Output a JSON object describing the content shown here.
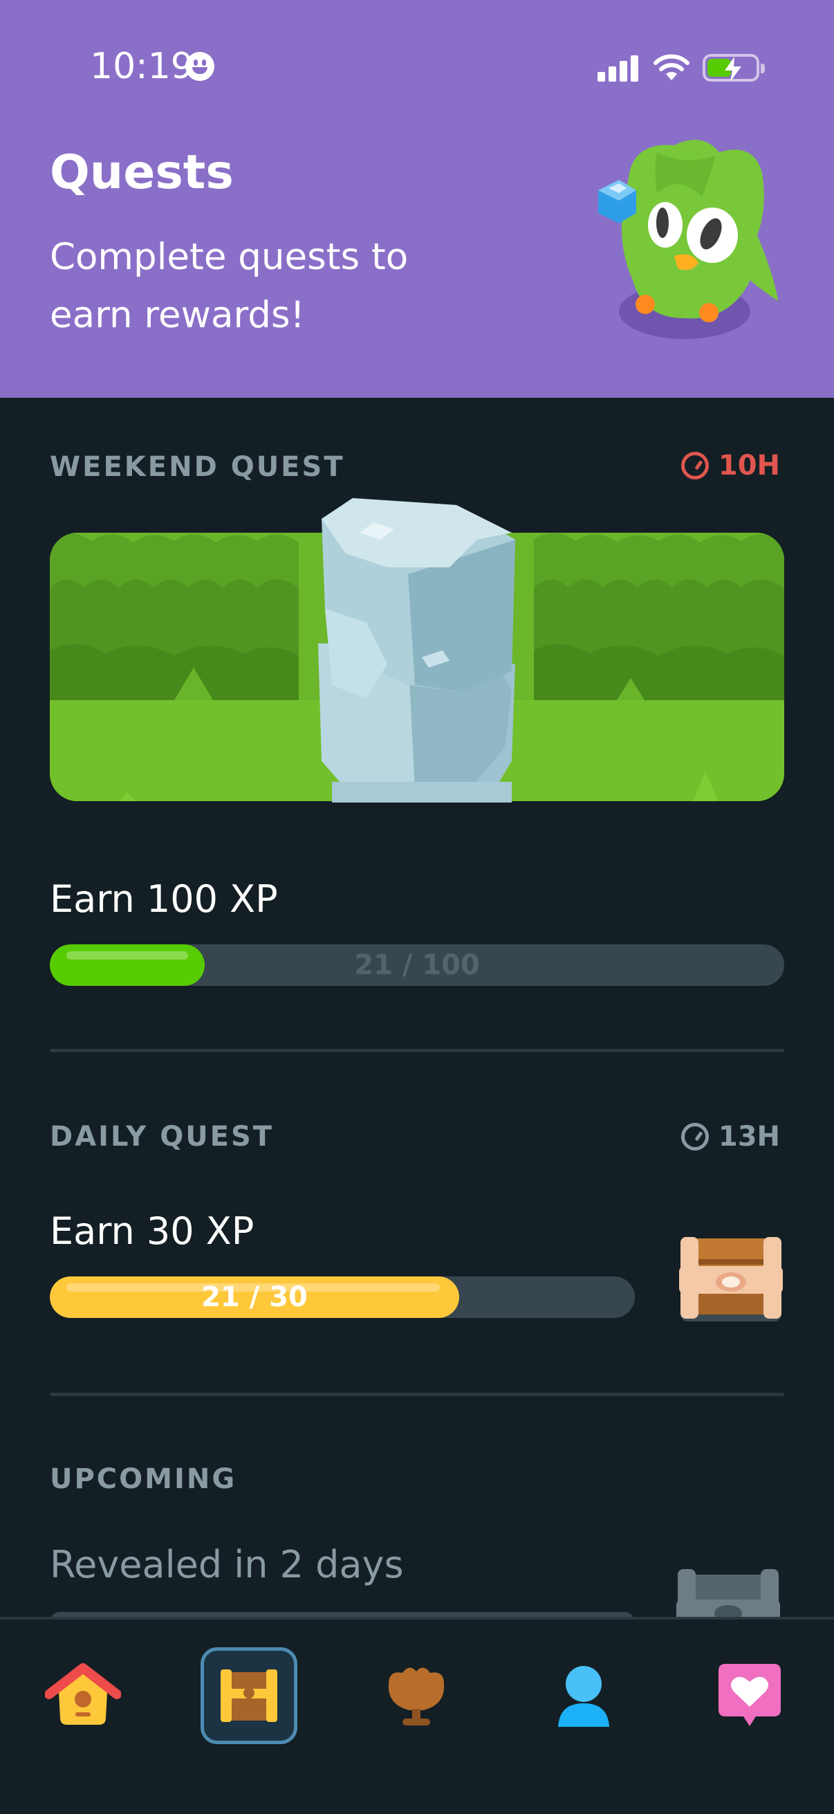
{
  "status_bar": {
    "time": "10:19"
  },
  "header": {
    "title": "Quests",
    "subtitle": "Complete quests to earn rewards!"
  },
  "weekend_quest": {
    "section_label": "WEEKEND QUEST",
    "timer": "10H",
    "timer_color": "#e0564e",
    "quest": {
      "name": "Earn 100 XP",
      "progress_text": "21 / 100",
      "progress_fraction": 0.21
    }
  },
  "daily_quest": {
    "section_label": "DAILY QUEST",
    "timer": "13H",
    "quest": {
      "name": "Earn 30 XP",
      "progress_text": "21 / 30",
      "progress_fraction": 0.7
    }
  },
  "upcoming": {
    "section_label": "UPCOMING",
    "text": "Revealed in 2 days"
  },
  "colors": {
    "header_bg": "#8a6fc8",
    "page_bg": "#131f24",
    "green_progress": "#58cc02",
    "yellow_progress": "#ffc83a",
    "progress_track": "#37464f",
    "label_gray": "#8a9aa3"
  },
  "nav": {
    "items": [
      {
        "icon": "home-icon"
      },
      {
        "icon": "quests-chest-icon",
        "active": true
      },
      {
        "icon": "leaderboard-trophy-icon"
      },
      {
        "icon": "profile-icon"
      },
      {
        "icon": "health-heart-icon"
      }
    ]
  }
}
